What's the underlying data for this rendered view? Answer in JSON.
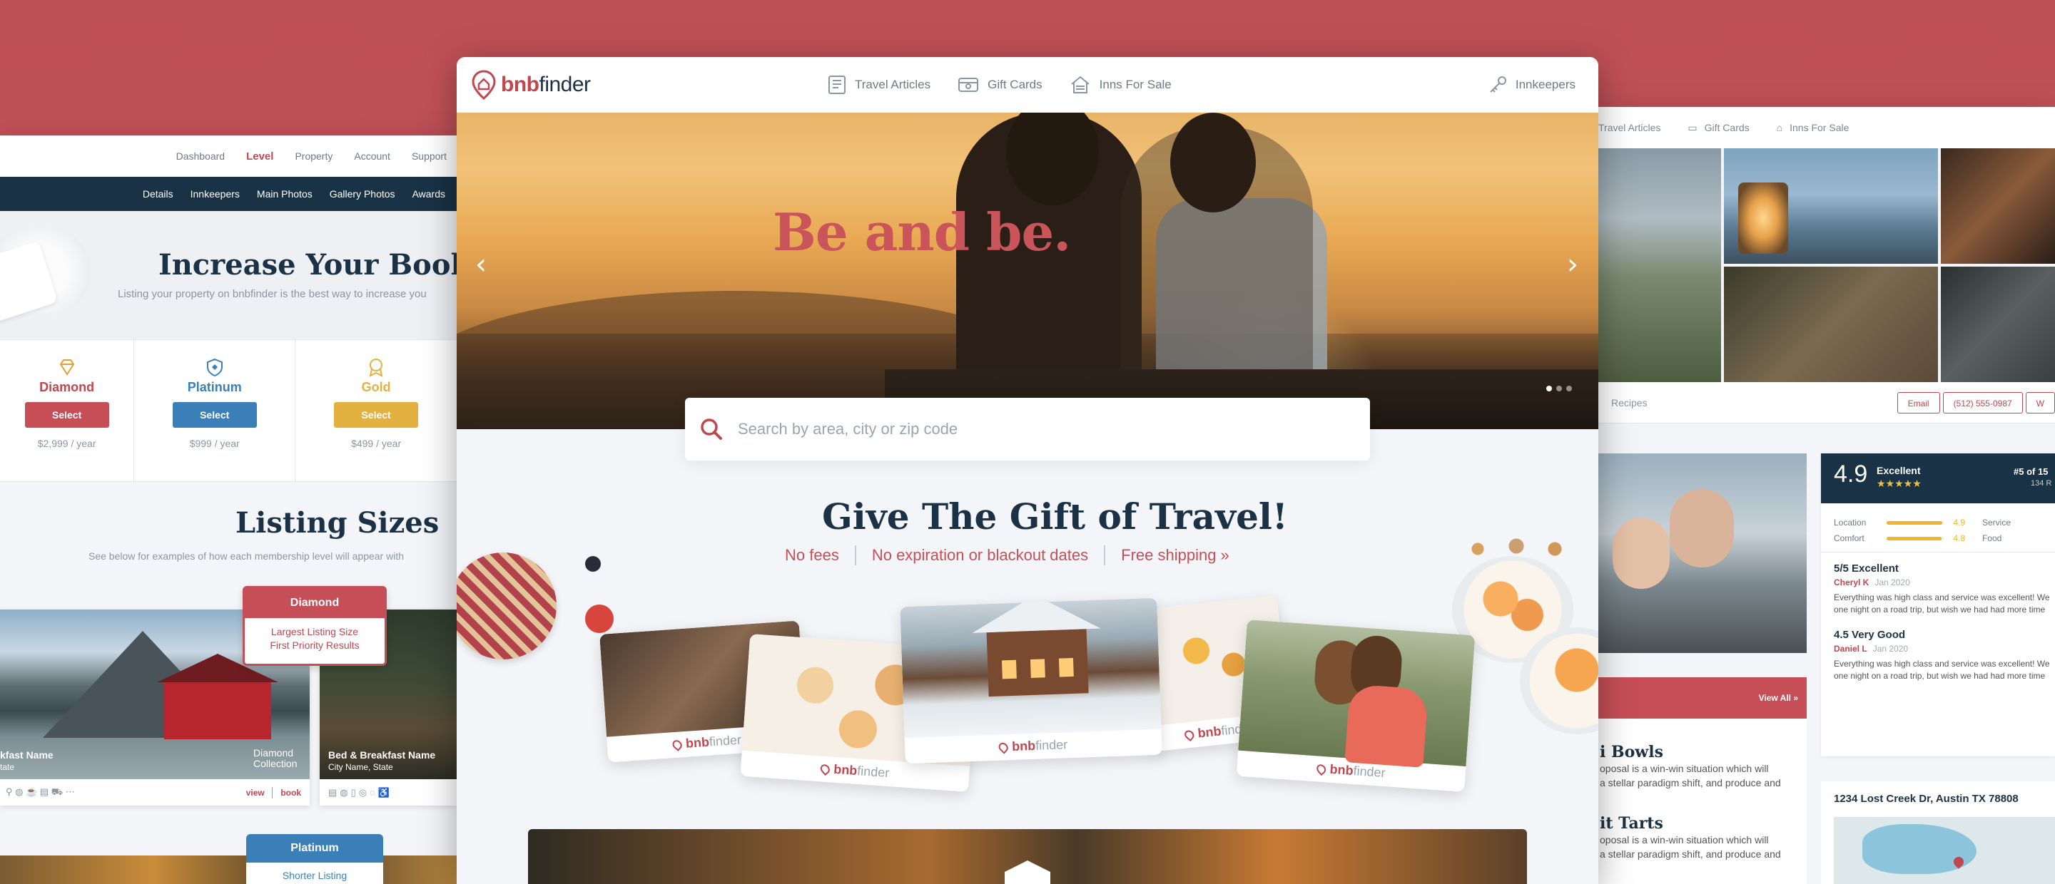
{
  "colors": {
    "brand": "#c0474f",
    "navy": "#193246",
    "platinum": "#3b7fb8",
    "gold": "#e3b13f"
  },
  "left": {
    "nav1": [
      "Dashboard",
      "Level",
      "Property",
      "Account",
      "Support"
    ],
    "nav2": [
      "Details",
      "Innkeepers",
      "Main Photos",
      "Gallery Photos",
      "Awards"
    ],
    "hero_title": "Increase Your Bookings",
    "hero_sub": "Listing your property on bnbfinder is the best way to increase you",
    "tiers": [
      {
        "name": "Diamond",
        "button": "Select",
        "price": "$2,999 / year",
        "icon": "diamond-icon"
      },
      {
        "name": "Platinum",
        "button": "Select",
        "price": "$999 / year",
        "icon": "shield-icon"
      },
      {
        "name": "Gold",
        "button": "Select",
        "price": "$499 / year",
        "icon": "medal-icon"
      }
    ],
    "sizes_title": "Listing Sizes",
    "sizes_sub": "See below for examples of how each membership level will appear with",
    "tip_diamond": {
      "title": "Diamond",
      "line1": "Largest Listing Size",
      "line2": "First Priority Results"
    },
    "tip_platinum": {
      "title": "Platinum",
      "line1": "Shorter Listing"
    },
    "card1": {
      "name": "kfast Name",
      "sub": "tate",
      "collection_line1": "Diamond",
      "collection_line2": "Collection",
      "view": "view",
      "book": "book"
    },
    "card2": {
      "name": "Bed & Breakfast Name",
      "sub": "City Name, State"
    }
  },
  "right": {
    "nav": [
      "Travel Articles",
      "Gift Cards",
      "Inns For Sale"
    ],
    "tab": "Recipes",
    "buttons": [
      "Email",
      "(512) 555-0987",
      "W"
    ],
    "score": "4.9",
    "score_label": "Excellent",
    "stars": "★★★★★",
    "rank": "#5 of 15",
    "rank_sub": "134 R",
    "ratings": [
      {
        "label": "Location",
        "value": "4.9",
        "label2": "Service"
      },
      {
        "label": "Comfort",
        "value": "4.8",
        "label2": "Food"
      }
    ],
    "reviews": [
      {
        "title": "5/5 Excellent",
        "author": "Cheryl K",
        "date": "Jan 2020",
        "text1": "Everything was high class and service was excellent! We",
        "text2": "one night on a road trip, but wish we had had more time"
      },
      {
        "title": "4.5 Very Good",
        "author": "Daniel L",
        "date": "Jan 2020",
        "text1": "Everything was high class and service was excellent! We",
        "text2": "one night on a road trip, but wish we had had more time"
      }
    ],
    "view_all": "View All »",
    "recipes": [
      {
        "title": "i Bowls",
        "line1": "oposal is a win-win situation which will",
        "line2": "a stellar paradigm shift, and produce and"
      },
      {
        "title": "it Tarts",
        "line1": "oposal is a win-win situation which will",
        "line2": "a stellar paradigm shift, and produce and"
      }
    ],
    "address": "1234 Lost Creek Dr, Austin TX 78808"
  },
  "center": {
    "logo_a": "bnb",
    "logo_b": "finder",
    "nav": [
      {
        "label": "Travel Articles",
        "icon": "article-icon"
      },
      {
        "label": "Gift Cards",
        "icon": "gift-card-icon"
      },
      {
        "label": "Inns For Sale",
        "icon": "house-icon"
      }
    ],
    "innkeepers": "Innkeepers",
    "hero_title": "Be and be.",
    "search_placeholder": "Search by area, city or zip code",
    "gift_title": "Give The Gift of Travel!",
    "perks": [
      "No fees",
      "No expiration or blackout dates",
      "Free shipping »"
    ],
    "card_logo_a": "bnb",
    "card_logo_b": "finder"
  }
}
